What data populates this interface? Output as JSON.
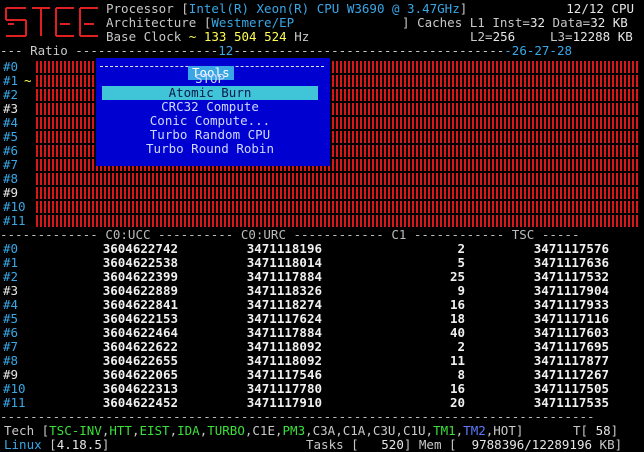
{
  "header": {
    "processor_label": "Processor [",
    "processor_value": "Intel(R) Xeon(R) CPU W3690 @ 3.47GHz",
    "processor_close": "]",
    "cpu_count": "12/12 CPU",
    "arch_label": "Architecture [",
    "arch_value": "Westmere/EP",
    "arch_close": "]",
    "caches_label": "Caches L1 Inst=",
    "l1_inst": "32",
    "l1_data_label": "Data=",
    "l1_data": "32 KB",
    "base_clock_label": "Base Clock",
    "base_clock_tilde": "~",
    "base_clock_value": "133 504 524",
    "base_clock_unit": "Hz",
    "l2_label": "L2=",
    "l2_value": "256",
    "l3_label": "L3=",
    "l3_value": "12288 KB"
  },
  "ratio_bar": {
    "left": "--- Ratio ",
    "mid_dashes": "-------------------",
    "mid_value": "12",
    "right_values": "-26-27-28"
  },
  "rows": [
    "#0",
    "#1",
    "#2",
    "#3",
    "#4",
    "#5",
    "#6",
    "#7",
    "#8",
    "#9",
    "#10",
    "#11"
  ],
  "tilde_marker": "~",
  "tools": {
    "title": "Tools",
    "items": [
      "STOP",
      "Atomic Burn",
      "CRC32 Compute",
      "Conic Compute...",
      "Turbo Random CPU",
      "Turbo Round Robin"
    ],
    "selected": 1
  },
  "table": {
    "header": "------------- C0:UCC ---------- C0:URC ------------ C1 ------------ TSC -----",
    "rows": [
      {
        "idx": "#0",
        "ucc": "3604622742",
        "urc": "3471118196",
        "c1": "2",
        "tsc": "3471117576"
      },
      {
        "idx": "#1",
        "ucc": "3604622538",
        "urc": "3471118014",
        "c1": "5",
        "tsc": "3471117636"
      },
      {
        "idx": "#2",
        "ucc": "3604622399",
        "urc": "3471117884",
        "c1": "25",
        "tsc": "3471117532"
      },
      {
        "idx": "#3",
        "ucc": "3604622889",
        "urc": "3471118326",
        "c1": "9",
        "tsc": "3471117904"
      },
      {
        "idx": "#4",
        "ucc": "3604622841",
        "urc": "3471118274",
        "c1": "16",
        "tsc": "3471117933"
      },
      {
        "idx": "#5",
        "ucc": "3604622153",
        "urc": "3471117624",
        "c1": "18",
        "tsc": "3471117116"
      },
      {
        "idx": "#6",
        "ucc": "3604622464",
        "urc": "3471117884",
        "c1": "40",
        "tsc": "3471117603"
      },
      {
        "idx": "#7",
        "ucc": "3604622622",
        "urc": "3471118092",
        "c1": "2",
        "tsc": "3471117695"
      },
      {
        "idx": "#8",
        "ucc": "3604622655",
        "urc": "3471118092",
        "c1": "11",
        "tsc": "3471117877"
      },
      {
        "idx": "#9",
        "ucc": "3604622065",
        "urc": "3471117546",
        "c1": "8",
        "tsc": "3471117267"
      },
      {
        "idx": "#10",
        "ucc": "3604622313",
        "urc": "3471117780",
        "c1": "16",
        "tsc": "3471117505"
      },
      {
        "idx": "#11",
        "ucc": "3604622452",
        "urc": "3471117910",
        "c1": "20",
        "tsc": "3471117535"
      }
    ]
  },
  "bottom_sep": "-------------------------------------------------------------------------------",
  "tech": {
    "label": "Tech [",
    "flags": [
      {
        "t": "TSC-INV",
        "c": "#3be03b"
      },
      {
        "t": "HTT",
        "c": "#3be03b"
      },
      {
        "t": "EIST",
        "c": "#3be03b"
      },
      {
        "t": "IDA",
        "c": "#3be03b"
      },
      {
        "t": "TURBO",
        "c": "#3be03b"
      },
      {
        "t": "C1E",
        "c": "#c8c8c8"
      },
      {
        "t": "PM3",
        "c": "#3be03b"
      },
      {
        "t": "C3A",
        "c": "#c8c8c8"
      },
      {
        "t": "C1A",
        "c": "#c8c8c8"
      },
      {
        "t": "C3U",
        "c": "#c8c8c8"
      },
      {
        "t": "C1U",
        "c": "#c8c8c8"
      },
      {
        "t": "TM1",
        "c": "#3be03b"
      },
      {
        "t": "TM2",
        "c": "#5a7bff"
      },
      {
        "t": "HOT",
        "c": "#c8c8c8"
      }
    ],
    "close": "]",
    "temp_label": "T[",
    "temp_value": "58",
    "temp_close": "]"
  },
  "status": {
    "os": "Linux",
    "kernel": "4.18.5",
    "tasks_label": "Tasks [",
    "tasks_value": "520",
    "mem_label": "] Mem [",
    "mem_value": "9788396/12289196",
    "mem_unit": "KB]"
  }
}
